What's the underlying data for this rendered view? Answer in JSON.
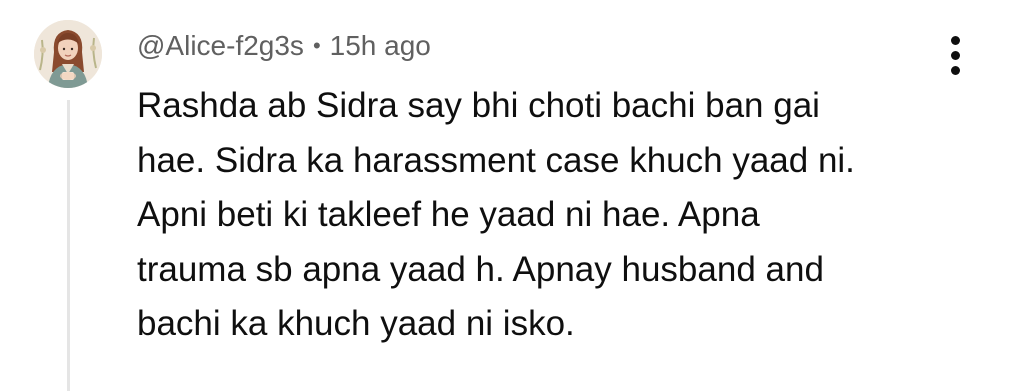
{
  "comment": {
    "author": "@Alice-f2g3s",
    "separator": "•",
    "timestamp": "15h ago",
    "lines": [
      "Rashda ab Sidra say bhi choti bachi ban gai",
      "hae. Sidra ka harassment case khuch yaad ni.",
      "Apni beti ki takleef he yaad ni hae. Apna",
      "trauma sb apna yaad h. Apnay husband and",
      "bachi ka khuch yaad ni isko."
    ],
    "avatar_icon": "avatar-illustration-woman",
    "more_icon": "more-vert-icon"
  },
  "colors": {
    "text_primary": "#0f0f0f",
    "text_secondary": "#606060",
    "thread_line": "#e5e5e5",
    "background": "#ffffff"
  }
}
